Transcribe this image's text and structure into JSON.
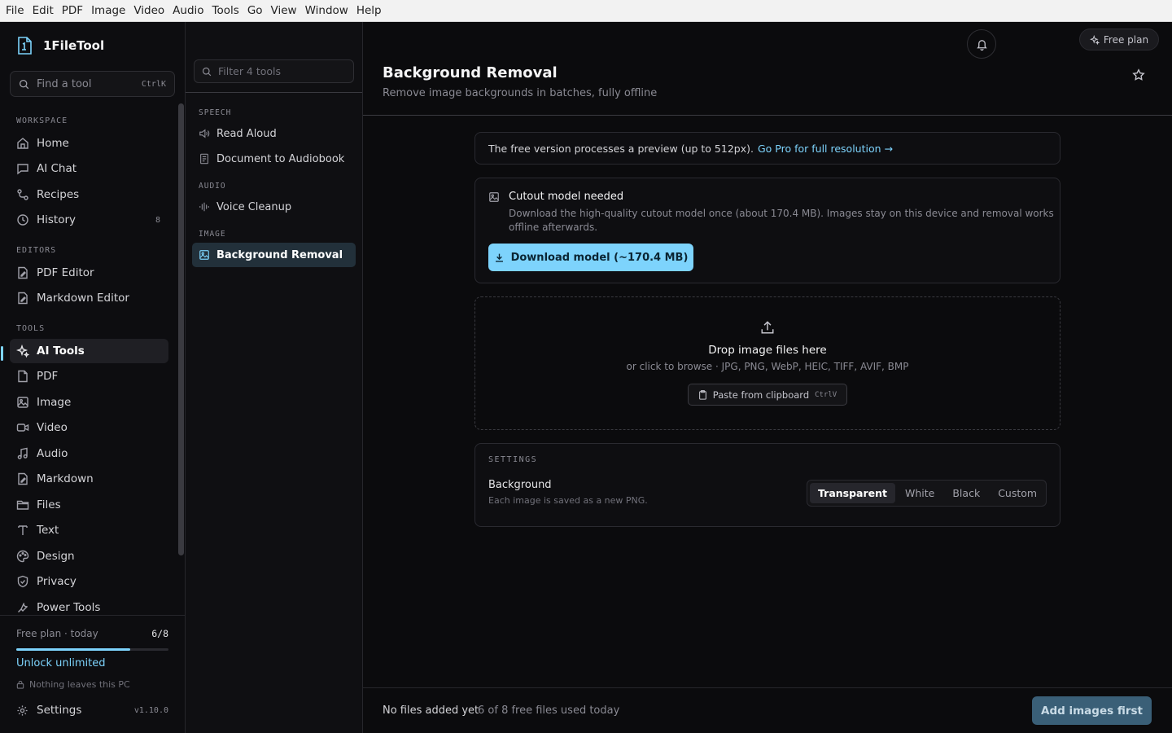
{
  "menubar": [
    "File",
    "Edit",
    "PDF",
    "Image",
    "Video",
    "Audio",
    "Tools",
    "Go",
    "View",
    "Window",
    "Help"
  ],
  "app": {
    "name": "1FileTool"
  },
  "search": {
    "placeholder": "Find a tool",
    "shortcut": "CtrlK"
  },
  "sidebar": {
    "sections": {
      "workspace": "WORKSPACE",
      "editors": "EDITORS",
      "tools": "TOOLS"
    },
    "workspace": [
      {
        "label": "Home",
        "icon": "home-icon"
      },
      {
        "label": "AI Chat",
        "icon": "chat-icon"
      },
      {
        "label": "Recipes",
        "icon": "recipes-icon"
      },
      {
        "label": "History",
        "icon": "history-icon",
        "count": "8"
      }
    ],
    "editors": [
      {
        "label": "PDF Editor",
        "icon": "pdf-editor-icon"
      },
      {
        "label": "Markdown Editor",
        "icon": "markdown-editor-icon"
      }
    ],
    "tools": [
      {
        "label": "AI Tools",
        "icon": "sparkle-icon",
        "active": true
      },
      {
        "label": "PDF",
        "icon": "file-icon"
      },
      {
        "label": "Image",
        "icon": "image-icon"
      },
      {
        "label": "Video",
        "icon": "video-icon"
      },
      {
        "label": "Audio",
        "icon": "music-icon"
      },
      {
        "label": "Markdown",
        "icon": "markdown-icon"
      },
      {
        "label": "Files",
        "icon": "folder-icon"
      },
      {
        "label": "Text",
        "icon": "text-icon"
      },
      {
        "label": "Design",
        "icon": "palette-icon"
      },
      {
        "label": "Privacy",
        "icon": "shield-icon"
      },
      {
        "label": "Power Tools",
        "icon": "power-tools-icon"
      }
    ]
  },
  "plan": {
    "label": "Free plan · today",
    "usage": "6/8",
    "usage_fraction": 0.75,
    "unlock": "Unlock unlimited",
    "privacy_note": "Nothing leaves this PC"
  },
  "settings_nav": {
    "label": "Settings",
    "version": "v1.10.0"
  },
  "toolpanel": {
    "filter_placeholder": "Filter 4 tools",
    "groups": [
      {
        "label": "SPEECH",
        "items": [
          "Read Aloud",
          "Document to Audiobook"
        ]
      },
      {
        "label": "AUDIO",
        "items": [
          "Voice Cleanup"
        ]
      },
      {
        "label": "IMAGE",
        "items": [
          "Background Removal"
        ]
      }
    ]
  },
  "header": {
    "free_plan_badge": "Free plan",
    "title": "Background Removal",
    "subtitle": "Remove image backgrounds in batches, fully offline"
  },
  "notice": {
    "text": "The free version processes a preview (up to 512px).",
    "link": "Go Pro for full resolution →"
  },
  "model": {
    "title": "Cutout model needed",
    "description": "Download the high-quality cutout model once (about 170.4 MB). Images stay on this device and removal works offline afterwards.",
    "button": "Download model (~170.4 MB)"
  },
  "dropzone": {
    "title": "Drop image files here",
    "subtitle": "or click to browse · JPG, PNG, WebP, HEIC, TIFF, AVIF, BMP",
    "paste_label": "Paste from clipboard",
    "paste_shortcut": "CtrlV"
  },
  "settings": {
    "section_label": "SETTINGS",
    "background_label": "Background",
    "background_hint": "Each image is saved as a new PNG.",
    "options": [
      "Transparent",
      "White",
      "Black",
      "Custom"
    ],
    "selected": "Transparent"
  },
  "footer": {
    "status": "No files added yet",
    "usage": "6 of 8 free files used today",
    "action": "Add images first"
  },
  "colors": {
    "accent": "#7dd3fc",
    "background": "#0b0b0d"
  }
}
